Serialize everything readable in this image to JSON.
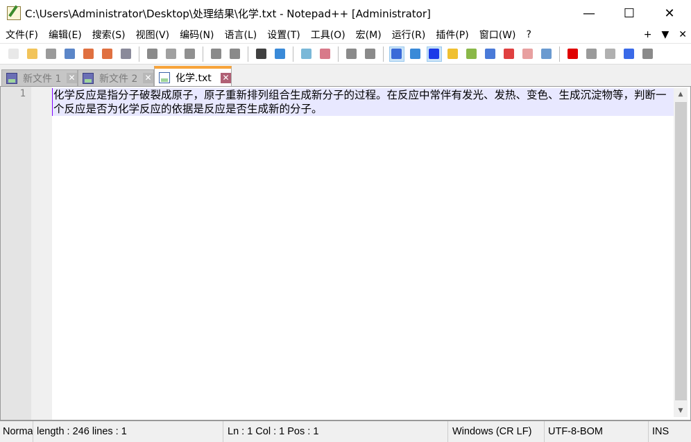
{
  "window": {
    "title": "C:\\Users\\Administrator\\Desktop\\处理结果\\化学.txt - Notepad++ [Administrator]",
    "minimize": "—",
    "maximize": "☐",
    "close": "✕"
  },
  "menu": [
    "文件(F)",
    "编辑(E)",
    "搜索(S)",
    "视图(V)",
    "编码(N)",
    "语言(L)",
    "设置(T)",
    "工具(O)",
    "宏(M)",
    "运行(R)",
    "插件(P)",
    "窗口(W)",
    "?"
  ],
  "menu_right": {
    "plus": "+",
    "down": "▼",
    "close": "✕"
  },
  "toolbar": [
    {
      "name": "new-file",
      "color": "#e8e8e8"
    },
    {
      "name": "open-file",
      "color": "#f2c45a"
    },
    {
      "name": "save",
      "color": "#9a9a9a"
    },
    {
      "name": "save-all",
      "color": "#5b86c8"
    },
    {
      "name": "close",
      "color": "#e07040"
    },
    {
      "name": "close-all",
      "color": "#e07040"
    },
    {
      "name": "print",
      "color": "#8a8a9a"
    },
    "|",
    {
      "name": "cut",
      "color": "#8a8a8a"
    },
    {
      "name": "copy",
      "color": "#a0a0a0"
    },
    {
      "name": "paste",
      "color": "#909090"
    },
    "|",
    {
      "name": "undo",
      "color": "#8a8a8a"
    },
    {
      "name": "redo",
      "color": "#8a8a8a"
    },
    "|",
    {
      "name": "find",
      "color": "#404040"
    },
    {
      "name": "replace",
      "color": "#3a8ad8"
    },
    "|",
    {
      "name": "zoom-in",
      "color": "#7ab8d8"
    },
    {
      "name": "zoom-out",
      "color": "#d87a8a"
    },
    "|",
    {
      "name": "sync-vertical",
      "color": "#8a8a8a"
    },
    {
      "name": "sync-horizontal",
      "color": "#8a8a8a"
    },
    "|",
    {
      "name": "word-wrap",
      "color": "#3a6ad8",
      "on": true
    },
    {
      "name": "show-all-chars",
      "color": "#3a8ad8"
    },
    {
      "name": "indent-guide",
      "color": "#1a3ae8",
      "on": true
    },
    {
      "name": "udl",
      "color": "#f0c030"
    },
    {
      "name": "document-map",
      "color": "#8ab848"
    },
    {
      "name": "document-list",
      "color": "#4a7ad8"
    },
    {
      "name": "function-list",
      "color": "#e04040"
    },
    {
      "name": "folder-as-workspace",
      "color": "#e8a0a0"
    },
    {
      "name": "monitoring",
      "color": "#6a9ad0"
    },
    "|",
    {
      "name": "start-recording",
      "color": "#e00000"
    },
    {
      "name": "stop-recording",
      "color": "#9a9a9a"
    },
    {
      "name": "playback",
      "color": "#b0b0b0"
    },
    {
      "name": "run-multiple",
      "color": "#3a6ae8"
    },
    {
      "name": "save-macro",
      "color": "#8a8a8a"
    }
  ],
  "tabs": [
    {
      "label": "新文件 1",
      "active": false
    },
    {
      "label": "新文件 2",
      "active": false
    },
    {
      "label": "化学.txt",
      "active": true
    }
  ],
  "editor": {
    "line_number": "1",
    "text": "化学反应是指分子破裂成原子，原子重新排列组合生成新分子的过程。在反应中常伴有发光、发热、变色、生成沉淀物等，判断一个反应是否为化学反应的依据是反应是否生成新的分子。"
  },
  "status": {
    "lang": "Normal text file",
    "length": "length : 246    lines : 1",
    "pos": "Ln : 1    Col : 1    Pos : 1",
    "eol": "Windows (CR LF)",
    "encoding": "UTF-8-BOM",
    "mode": "INS"
  }
}
